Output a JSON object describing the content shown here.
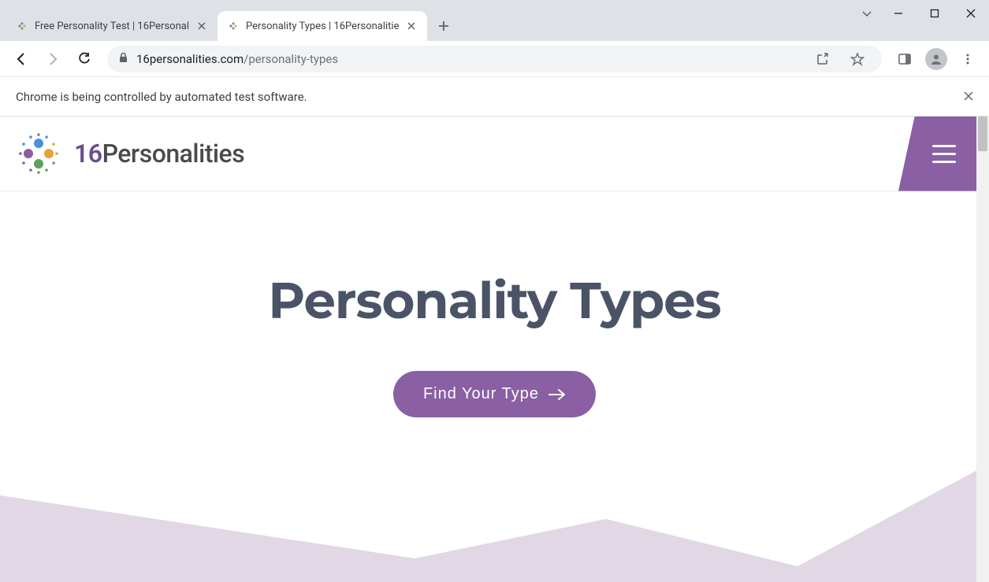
{
  "browser": {
    "tabs": [
      {
        "title": "Free Personality Test | 16Personal",
        "active": false
      },
      {
        "title": "Personality Types | 16Personalitie",
        "active": true
      }
    ],
    "url_domain": "16personalities.com",
    "url_path": "/personality-types"
  },
  "infobar": {
    "message": "Chrome is being controlled by automated test software."
  },
  "site": {
    "logo_prefix": "16",
    "logo_text": "Personalities"
  },
  "hero": {
    "title": "Personality Types",
    "cta_label": "Find Your Type"
  },
  "colors": {
    "brand_purple": "#8a5fa3",
    "heading": "#4b5367",
    "wave": "#e2d7e5"
  }
}
